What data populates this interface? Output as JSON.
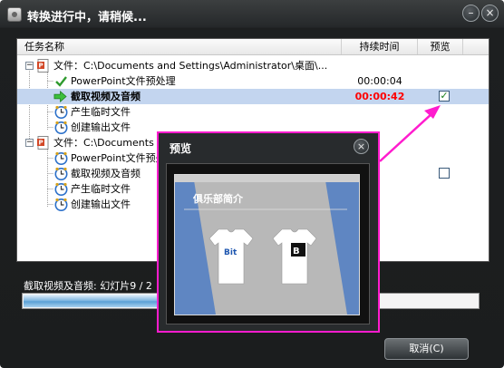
{
  "window": {
    "title": "转换进行中，请稍候...",
    "minimize_label": "–",
    "close_label": "×",
    "accent_color": "#ff1cce"
  },
  "table": {
    "columns": [
      "任务名称",
      "持续时间",
      "预览"
    ],
    "rows": [
      {
        "kind": "file",
        "label": "文件：C:\\Documents and Settings\\Administrator\\桌面\\...",
        "duration": "",
        "icon": "powerpoint-file-icon"
      },
      {
        "kind": "task",
        "label": "PowerPoint文件预处理",
        "duration": "00:00:04",
        "icon": "checkmark-icon",
        "status": "done"
      },
      {
        "kind": "task",
        "label": "截取视频及音频",
        "duration": "00:00:42",
        "icon": "arrow-right-icon",
        "status": "active",
        "selected": true,
        "preview_checked": true
      },
      {
        "kind": "task",
        "label": "产生临时文件",
        "duration": "",
        "icon": "clock-icon",
        "status": "pending"
      },
      {
        "kind": "task",
        "label": "创建输出文件",
        "duration": "",
        "icon": "clock-icon",
        "status": "pending"
      },
      {
        "kind": "file",
        "label": "文件：C:\\Documents a",
        "duration": "",
        "icon": "powerpoint-file-icon"
      },
      {
        "kind": "task",
        "label": "PowerPoint文件预处",
        "duration": "",
        "icon": "clock-icon",
        "status": "pending"
      },
      {
        "kind": "task",
        "label": "截取视频及音频",
        "duration": "",
        "icon": "clock-icon",
        "status": "pending",
        "preview_checked": false
      },
      {
        "kind": "task",
        "label": "产生临时文件",
        "duration": "",
        "icon": "clock-icon",
        "status": "pending"
      },
      {
        "kind": "task",
        "label": "创建输出文件",
        "duration": "",
        "icon": "clock-icon",
        "status": "pending"
      }
    ]
  },
  "status": {
    "text": "截取视频及音频: 幻灯片9 / 2",
    "progress_fraction": 0.3
  },
  "buttons": {
    "cancel": "取消(C)"
  },
  "preview": {
    "title": "预览",
    "close_label": "×",
    "slide_heading": "俱乐部简介",
    "shirt_left_logo": "Bit",
    "shirt_right_logo": "B"
  }
}
